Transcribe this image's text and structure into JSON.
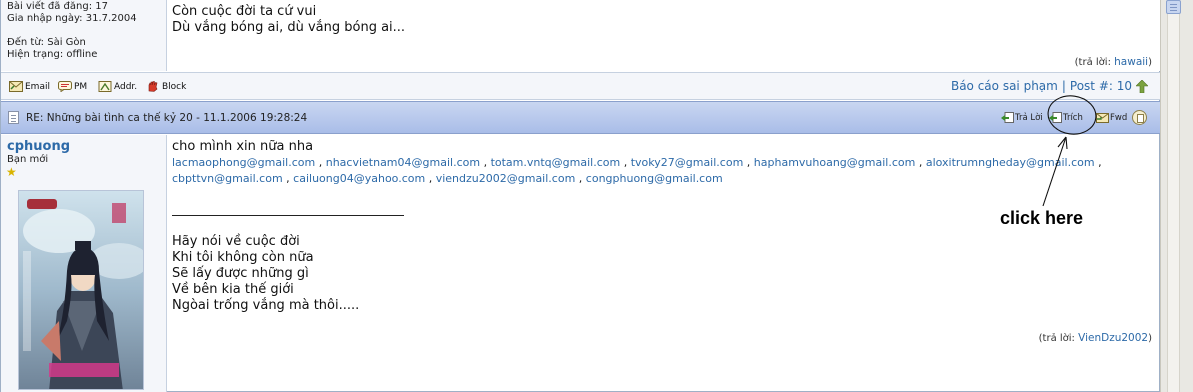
{
  "post1": {
    "meta": [
      "Bài viết đã đăng: 17",
      "Gia nhập ngày: 31.7.2004",
      "",
      "Đến từ: Sài Gòn",
      "Hiện trạng: offline"
    ],
    "lines": [
      "Còn cuộc đời ta cứ vui",
      "Dù vắng bóng ai, dù vắng bóng ai..."
    ],
    "reply_prefix": "(trả lời:",
    "reply_name": "hawaii",
    "reply_suffix": ")"
  },
  "toolbar": {
    "email": "Email",
    "pm": "PM",
    "addr": "Addr.",
    "block": "Block",
    "report": "Báo cáo sai phạm",
    "separator": "|",
    "post_number": "Post #: 10"
  },
  "post2": {
    "header_title": "RE: Những bài tình ca thế kỷ 20 - 11.1.2006 19:28:24",
    "btn_reply": "Trả Lời",
    "btn_quote": "Trích",
    "btn_fwd": "Fwd",
    "username": "cphuong",
    "rank": "Bạn mới",
    "greeting": "cho mình xin nữa nha",
    "emails_row1": [
      "lacmaophong@gmail.com",
      "nhacvietnam04@gmail.com",
      "totam.vntq@gmail.com",
      "tvoky27@gmail.com",
      "haphamvuhoang@gmail.com",
      "aloxitrumngheday@gmail.com"
    ],
    "emails_row2": [
      "cbpttvn@gmail.com",
      "cailuong04@yahoo.com",
      "viendzu2002@gmail.com",
      "congphuong@gmail.com"
    ],
    "email_sep": ",",
    "poem": [
      "Hãy nói về cuộc đời",
      "Khi tôi không còn nữa",
      "Sẽ lấy được những gì",
      "Về bên kia thế giới",
      "Ngòai trống vắng mà thôi....."
    ],
    "reply_prefix": "(trả lời:",
    "reply_name": "VienDzu2002",
    "reply_suffix": ")"
  },
  "annotation": "click here"
}
